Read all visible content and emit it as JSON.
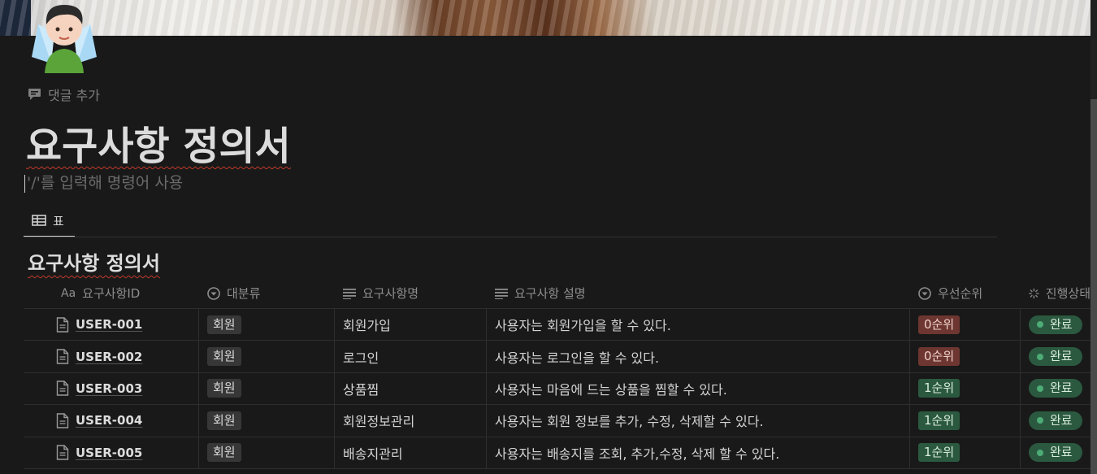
{
  "page": {
    "comment_action": "댓글 추가",
    "title": "요구사항 정의서",
    "placeholder": "'/'를 입력해 명령어 사용"
  },
  "view_tab": {
    "label": "표",
    "icon": "table-icon"
  },
  "database": {
    "title": "요구사항 정의서",
    "columns": [
      {
        "label": "요구사항ID",
        "icon": "Aa"
      },
      {
        "label": "대분류",
        "icon": "select-icon"
      },
      {
        "label": "요구사항명",
        "icon": "text-lines-icon"
      },
      {
        "label": "요구사항 설명",
        "icon": "text-lines-icon"
      },
      {
        "label": "우선순위",
        "icon": "select-icon"
      },
      {
        "label": "진행상태",
        "icon": "status-icon"
      }
    ],
    "rows": [
      {
        "id": "USER-001",
        "category": "회원",
        "name": "회원가입",
        "description": "사용자는 회원가입을 할 수 있다.",
        "priority": "0순위",
        "status": "완료"
      },
      {
        "id": "USER-002",
        "category": "회원",
        "name": "로그인",
        "description": "사용자는 로그인을 할 수 있다.",
        "priority": "0순위",
        "status": "완료"
      },
      {
        "id": "USER-003",
        "category": "회원",
        "name": "상품찜",
        "description": "사용자는 마음에 드는 상품을 찜할 수 있다.",
        "priority": "1순위",
        "status": "완료"
      },
      {
        "id": "USER-004",
        "category": "회원",
        "name": "회원정보관리",
        "description": "사용자는 회원 정보를 추가, 수정, 삭제할 수 있다.",
        "priority": "1순위",
        "status": "완료"
      },
      {
        "id": "USER-005",
        "category": "회원",
        "name": "배송지관리",
        "description": "사용자는 배송지를 조회, 추가,수정, 삭제 할 수 있다.",
        "priority": "1순위",
        "status": "완료"
      }
    ]
  },
  "colors": {
    "background": "#191919",
    "priority_0": "#6e3630",
    "priority_1": "#2b5940",
    "status_done": "#2b5940",
    "spellcheck": "#c0392b"
  }
}
